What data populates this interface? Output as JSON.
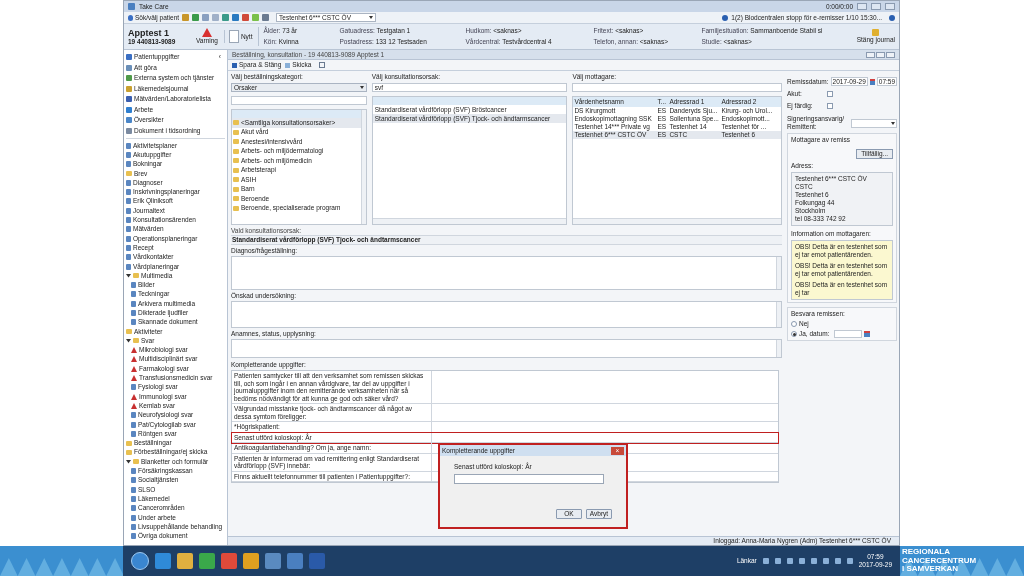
{
  "window": {
    "title": "Take Care",
    "media_time": "0:00/0:00"
  },
  "toolbar": {
    "patient_button": "Sök/välj patient",
    "unit": "Testenhet 6*** CSTC ÖV",
    "notice": "1(2) Blodcentralen stopp för e-remisser 1/10 15:30..."
  },
  "patient": {
    "name": "Apptest 1",
    "id": "19 440813-9089",
    "warning": "Varning",
    "new": "Nytt",
    "close_journal": "Stäng journal",
    "fields": [
      {
        "label": "Ålder:",
        "value": "73 år"
      },
      {
        "label": "Gatuadress:",
        "value": "Testgatan 1"
      },
      {
        "label": "Hudkom:",
        "value": "<saknas>"
      },
      {
        "label": "Fritext:",
        "value": "<saknas>"
      },
      {
        "label": "Familjesituation:",
        "value": "Sammanboende Stabil si"
      },
      {
        "label": "Kön:",
        "value": "Kvinna"
      },
      {
        "label": "Postadress:",
        "value": "133 12 Testsaden"
      },
      {
        "label": "Vårdcentral:",
        "value": "Testvårdcentral 4"
      },
      {
        "label": "Telefon, annan:",
        "value": "<saknas>"
      },
      {
        "label": "Studie:",
        "value": "<saknas>"
      }
    ]
  },
  "sidebar": {
    "collapse": "‹",
    "items": [
      {
        "label": "Patientuppgifter",
        "color": "#3a6fc4"
      },
      {
        "label": "Att göra",
        "color": "#6a8fb8"
      },
      {
        "label": "Externa system och tjänster",
        "color": "#4f9a4a"
      },
      {
        "label": "Läkemedelsjournal",
        "color": "#c9a030"
      },
      {
        "label": "Mätvärden/Laboratorielista",
        "color": "#3a5fb0"
      },
      {
        "label": "Arbete",
        "color": "#2f7fd0"
      },
      {
        "label": "Översikter",
        "color": "#4a86c8"
      },
      {
        "label": "Dokument i tidsordning",
        "color": "#7a8aa0"
      }
    ],
    "tree": [
      {
        "label": "Aktivitetsplaner",
        "kind": "item"
      },
      {
        "label": "Akutuppgifter",
        "kind": "item"
      },
      {
        "label": "Bokningar",
        "kind": "item"
      },
      {
        "label": "Brev",
        "kind": "folder"
      },
      {
        "label": "Diagnoser",
        "kind": "item"
      },
      {
        "label": "Inskrivningsplaneringar",
        "kind": "item"
      },
      {
        "label": "Erik Qliniksoft",
        "kind": "item"
      },
      {
        "label": "Journaltext",
        "kind": "item"
      },
      {
        "label": "Konsultationsärenden",
        "kind": "item"
      },
      {
        "label": "Mätvärden",
        "kind": "item"
      },
      {
        "label": "Operationsplaneringar",
        "kind": "item"
      },
      {
        "label": "Recept",
        "kind": "item"
      },
      {
        "label": "Vårdkontakter",
        "kind": "item"
      },
      {
        "label": "Vårdplaneringar",
        "kind": "item"
      },
      {
        "label": "Multimedia",
        "kind": "folder",
        "expanded": true,
        "children": [
          {
            "label": "Bilder",
            "kind": "item"
          },
          {
            "label": "Teckningar",
            "kind": "item"
          },
          {
            "label": "Arkivera multimedia",
            "kind": "item"
          },
          {
            "label": "Dikterade ljudfiler",
            "kind": "item"
          },
          {
            "label": "Skannade dokument",
            "kind": "item"
          }
        ]
      },
      {
        "label": "Aktiviteter",
        "kind": "folder"
      },
      {
        "label": "Svar",
        "kind": "folder",
        "expanded": true,
        "children": [
          {
            "label": "Mikrobiologi svar",
            "kind": "alert"
          },
          {
            "label": "Multidisciplinärt svar",
            "kind": "alert"
          },
          {
            "label": "Farmakologi svar",
            "kind": "alert"
          },
          {
            "label": "Transfusionsmedicin svar",
            "kind": "alert"
          },
          {
            "label": "Fysiologi svar",
            "kind": "item"
          },
          {
            "label": "Immunologi svar",
            "kind": "alert"
          },
          {
            "label": "Kemlab svar",
            "kind": "alert"
          },
          {
            "label": "Neurofysiologi svar",
            "kind": "item"
          },
          {
            "label": "Pat/Cytologilab svar",
            "kind": "item"
          },
          {
            "label": "Röntgen svar",
            "kind": "item"
          }
        ]
      },
      {
        "label": "Beställningar",
        "kind": "folder"
      },
      {
        "label": "Förbeställningar/ej skicka",
        "kind": "folder"
      },
      {
        "label": "Blanketter och formulär",
        "kind": "folder",
        "expanded": true,
        "children": [
          {
            "label": "Försäkringskassan",
            "kind": "item"
          },
          {
            "label": "Socialtjänsten",
            "kind": "item"
          },
          {
            "label": "SLSO",
            "kind": "item"
          },
          {
            "label": "Läkemedel",
            "kind": "item"
          },
          {
            "label": "Cancerområden",
            "kind": "item"
          },
          {
            "label": "Under arbete",
            "kind": "item"
          },
          {
            "label": "Livsuppehållande behandling",
            "kind": "item"
          },
          {
            "label": "Övriga dokument",
            "kind": "item"
          }
        ]
      }
    ]
  },
  "document": {
    "tab_title": "Beställning, konsultation - 19 440813-9089 Apptest 1",
    "actions": [
      "Spara & Stäng",
      "Skicka"
    ],
    "category": {
      "label": "Välj beställningskategori:",
      "value": "Orsaker",
      "items": [
        {
          "label": "<Samtliga konsultationsorsaker>",
          "selected": true
        },
        {
          "label": "Akut vård",
          "selected": false
        },
        {
          "label": "Anestesi/intensivvård",
          "selected": false
        },
        {
          "label": "Arbets- och miljödermatologi",
          "selected": false
        },
        {
          "label": "Arbets- och miljömedicin",
          "selected": false
        },
        {
          "label": "Arbetsterapi",
          "selected": false
        },
        {
          "label": "ASIH",
          "selected": false
        },
        {
          "label": "Barn",
          "selected": false
        },
        {
          "label": "Beroende",
          "selected": false
        },
        {
          "label": "Beroende, specialiserade program",
          "selected": false
        }
      ]
    },
    "reason": {
      "label": "Välj konsultationsorsak:",
      "value": "svf",
      "items": [
        {
          "label": "Standardiserat vårdförlopp (SVF) Bröstcancer",
          "selected": false
        },
        {
          "label": "Standardiserat vårdförlopp (SVF) Tjock- och ändtarmscancer",
          "selected": true
        }
      ]
    },
    "recipient": {
      "label": "Välj mottagare:",
      "columns": [
        "Vårdenhetsnamn",
        "T...",
        "Adressrad 1",
        "Adressrad 2"
      ],
      "rows": [
        {
          "cells": [
            "DS Kirurgmott",
            "ES",
            "Danderyds Sju...",
            "Kirurg- och Urol..."
          ],
          "selected": false
        },
        {
          "cells": [
            "Endoskopimottagning SSK",
            "ES",
            "Sollentuna Spe...",
            "Endoskopimott..."
          ],
          "selected": false
        },
        {
          "cells": [
            "Testenhet 14*** Private vg",
            "ES",
            "Testenhet 14",
            "Testenhet för ..."
          ],
          "selected": false
        },
        {
          "cells": [
            "Testenhet 6*** CSTC ÖV",
            "ES",
            "CSTC",
            "Testenhet 6"
          ],
          "selected": true
        }
      ]
    },
    "chosen_label": "Vald konsultationsorsak:",
    "chosen_value": "Standardiserat vårdförlopp (SVF) Tjock- och ändtarmscancer",
    "diagnosis_label": "Diagnos/frågeställning:",
    "exam_label": "Önskad undersökning:",
    "history_label": "Anamnes, status, upplysning:",
    "extra_label": "Kompletterande uppgifter:",
    "extra_rows": [
      {
        "text": "Patienten samtycker till att den verksamhet som remissen skickas till, och som ingår i en annan vårdgivare, tar del av uppgifter i journaluppgifter inom den remitterande verksamheten när så bedöms nödvändigt för att kunna ge god och säker vård?",
        "highlighted": false
      },
      {
        "text": "Välgrundad misstanke tjock- och ändtarmscancer då något av dessa symtom föreligger:",
        "highlighted": false
      },
      {
        "text": "*Högriskpatient:",
        "highlighted": false
      },
      {
        "text": "Senast utförd koloskopi: År",
        "highlighted": true
      },
      {
        "text": "Antikoagulantiabehandling? Om ja, ange namn:",
        "highlighted": false
      },
      {
        "text": "Patienten är informerad om vad remittering enligt Standardiserat vårdförlopp (SVF) innebär:",
        "highlighted": false
      },
      {
        "text": "Finns aktuellt telefonnummer till patienten i Patientuppgifter?:",
        "highlighted": false
      }
    ],
    "dialog": {
      "title": "Kompletterande uppgifter",
      "close": "×",
      "label": "Senast utförd koloskopi: År",
      "buttons": [
        "OK",
        "Avbryt"
      ]
    },
    "side": {
      "date_label": "Remissdatum:",
      "date": "2017-09-29",
      "time": "07:59",
      "checks": [
        {
          "label": "Akut:",
          "checked": false
        },
        {
          "label": "Ej färdig:",
          "checked": false
        }
      ],
      "signer_label": "Signeringsansvarig/ Remittent:",
      "recipient_label": "Mottagare av remiss",
      "temp_button": "Tillfällig...",
      "address_label": "Adress:",
      "address": [
        "Testenhet 6*** CSTC ÖV",
        "CSTC",
        "Testenhet 6",
        "Folkungag 44",
        "Stockholm",
        "tel 08-333 742 92"
      ],
      "info_label": "Information om mottagaren:",
      "info": [
        "OBS! Detta är en testenhet som ej tar emot patientärenden.",
        "OBS! Detta är en testenhet som ej tar emot patientärenden.",
        "OBS! Detta är en testenhet som ej tar"
      ],
      "answer_label": "Besvara remissen:",
      "answer_options": [
        {
          "label": "Nej",
          "selected": false
        },
        {
          "label": "Ja, datum:",
          "selected": true
        }
      ]
    }
  },
  "status_bar": "Inloggad: Anna-Maria Nygren (Adm) Testenhet 6*** CSTC ÖV",
  "taskbar": {
    "tray_label": "Länkar",
    "time": "07:59",
    "date": "2017-09-29"
  },
  "banner": [
    "REGIONALA",
    "CANCERCENTRUM",
    "I SAMVERKAN"
  ]
}
